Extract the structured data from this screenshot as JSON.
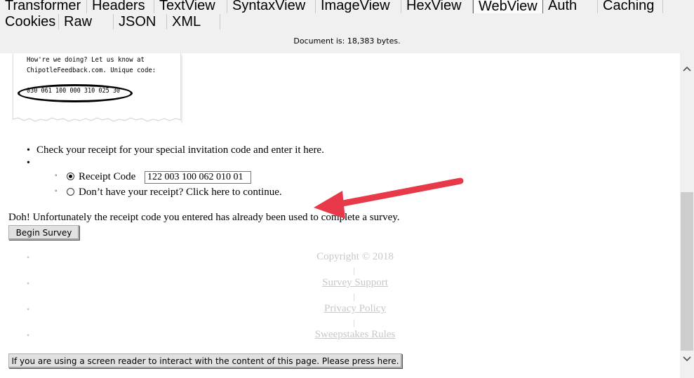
{
  "tabs": {
    "row1": [
      "Transformer",
      "Headers",
      "TextView",
      "SyntaxView",
      "ImageView",
      "HexView",
      "WebView",
      "Auth",
      "Caching"
    ],
    "row2": [
      "Cookies",
      "Raw",
      "JSON",
      "XML"
    ],
    "active": "WebView"
  },
  "document_info": "Document is: 18,383 bytes.",
  "receipt": {
    "line1": "How're we doing? Let us know at",
    "line2": "ChipotleFeedback.com. Unique code:",
    "code": "030 061 100 000 310 025 30"
  },
  "instructions": "Check your receipt for your special invitation code and enter it here.",
  "options": {
    "receipt_code_label": "Receipt Code",
    "receipt_code_value": "122 003 100 062 010 01",
    "no_receipt_label": "Don’t have your receipt? Click here to continue."
  },
  "error_message": "Doh! Unfortunately the receipt code you entered has already been used to complete a survey.",
  "begin_button": "Begin Survey",
  "footer": {
    "copyright": "Copyright © 2018",
    "separator": "|",
    "links": [
      "Survey Support",
      "Privacy Policy",
      "Sweepstakes Rules"
    ]
  },
  "screen_reader_button": "If you are using a screen reader to interact with the content of this page. Please press here.",
  "colors": {
    "annotation_arrow": "#e8394a",
    "footer_text": "#c8c8c8"
  },
  "icons": {
    "scroll_up": "chevron-up-icon",
    "scroll_down": "chevron-down-icon"
  }
}
